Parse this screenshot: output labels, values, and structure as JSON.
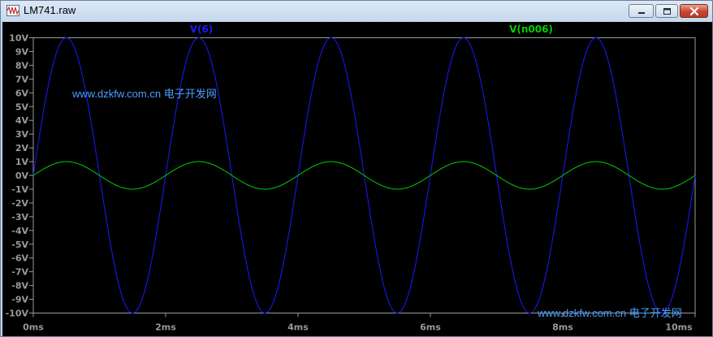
{
  "window": {
    "title": "LM741.raw",
    "controls": {
      "minimize": "minimize",
      "maximize": "maximize",
      "close": "close"
    }
  },
  "watermarks": [
    {
      "text": "www.dzkfw.com.cn",
      "suffix": "电子开发网",
      "color": "#4aa0ff"
    },
    {
      "text": "www.dzkfw.com.cn",
      "suffix": "电子开发网",
      "color": "#4aa0ff"
    }
  ],
  "colors": {
    "background": "#000000",
    "axis": "#9a9a9a",
    "series_v6": "#1a1aff",
    "series_vn006": "#00d000"
  },
  "chart_data": {
    "type": "line",
    "title": "",
    "xlabel": "",
    "ylabel": "",
    "xlim": [
      0,
      10
    ],
    "ylim": [
      -10,
      10
    ],
    "x_unit": "ms",
    "y_unit": "V",
    "x_ticks": [
      "0ms",
      "2ms",
      "4ms",
      "6ms",
      "8ms",
      "10ms"
    ],
    "y_ticks": [
      "10V",
      "9V",
      "8V",
      "7V",
      "6V",
      "5V",
      "4V",
      "3V",
      "2V",
      "1V",
      "0V",
      "-1V",
      "-2V",
      "-3V",
      "-4V",
      "-5V",
      "-6V",
      "-7V",
      "-8V",
      "-9V",
      "-10V"
    ],
    "grid": false,
    "legend": "top",
    "series": [
      {
        "name": "V(6)",
        "color": "#1a1aff",
        "waveform": "sine",
        "amplitude": 10,
        "frequency_hz": 500,
        "offset": 0,
        "x": [
          0,
          0.5,
          1,
          1.5,
          2,
          2.5,
          3,
          3.5,
          4,
          4.5,
          5,
          5.5,
          6,
          6.5,
          7,
          7.5,
          8,
          8.5,
          9,
          9.5,
          10
        ],
        "y": [
          0,
          10,
          0,
          -10,
          0,
          10,
          0,
          -10,
          0,
          10,
          0,
          -10,
          0,
          10,
          0,
          -10,
          0,
          10,
          0,
          -10,
          0
        ]
      },
      {
        "name": "V(n006)",
        "color": "#00d000",
        "waveform": "sine",
        "amplitude": 1,
        "frequency_hz": 500,
        "offset": 0,
        "x": [
          0,
          0.5,
          1,
          1.5,
          2,
          2.5,
          3,
          3.5,
          4,
          4.5,
          5,
          5.5,
          6,
          6.5,
          7,
          7.5,
          8,
          8.5,
          9,
          9.5,
          10
        ],
        "y": [
          0,
          1,
          0,
          -1,
          0,
          1,
          0,
          -1,
          0,
          1,
          0,
          -1,
          0,
          1,
          0,
          -1,
          0,
          1,
          0,
          -1,
          0
        ]
      }
    ]
  }
}
